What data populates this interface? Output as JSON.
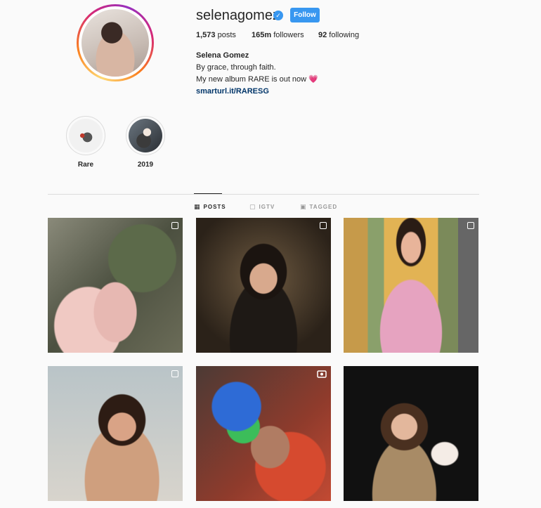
{
  "profile": {
    "username": "selenagomez",
    "verified_mark": "✓",
    "follow_label": "Follow",
    "stats": {
      "posts_count": "1,573",
      "posts_label": " posts",
      "followers_count": "165m",
      "followers_label": " followers",
      "following_count": "92",
      "following_label": " following"
    },
    "full_name": "Selena Gomez",
    "bio_line1": "By grace, through faith.",
    "bio_line2": "My new album RARE is out now",
    "bio_emoji": "💗",
    "link": "smarturl.it/RARESG"
  },
  "highlights": [
    {
      "label": "Rare"
    },
    {
      "label": "2019"
    }
  ],
  "tabs": [
    {
      "label": "POSTS",
      "icon": "grid-icon",
      "active": true
    },
    {
      "label": "IGTV",
      "icon": "tv-icon",
      "active": false
    },
    {
      "label": "TAGGED",
      "icon": "tag-icon",
      "active": false
    }
  ],
  "posts": [
    {
      "badge": "carousel-icon"
    },
    {
      "badge": "carousel-icon"
    },
    {
      "badge": "carousel-icon"
    },
    {
      "badge": "carousel-icon"
    },
    {
      "badge": "video-icon"
    },
    {
      "badge": "none"
    }
  ],
  "colors": {
    "accent_blue": "#3897f0",
    "link_dark_blue": "#003569",
    "text": "#262626",
    "muted": "#999999",
    "background": "#fafafa"
  }
}
